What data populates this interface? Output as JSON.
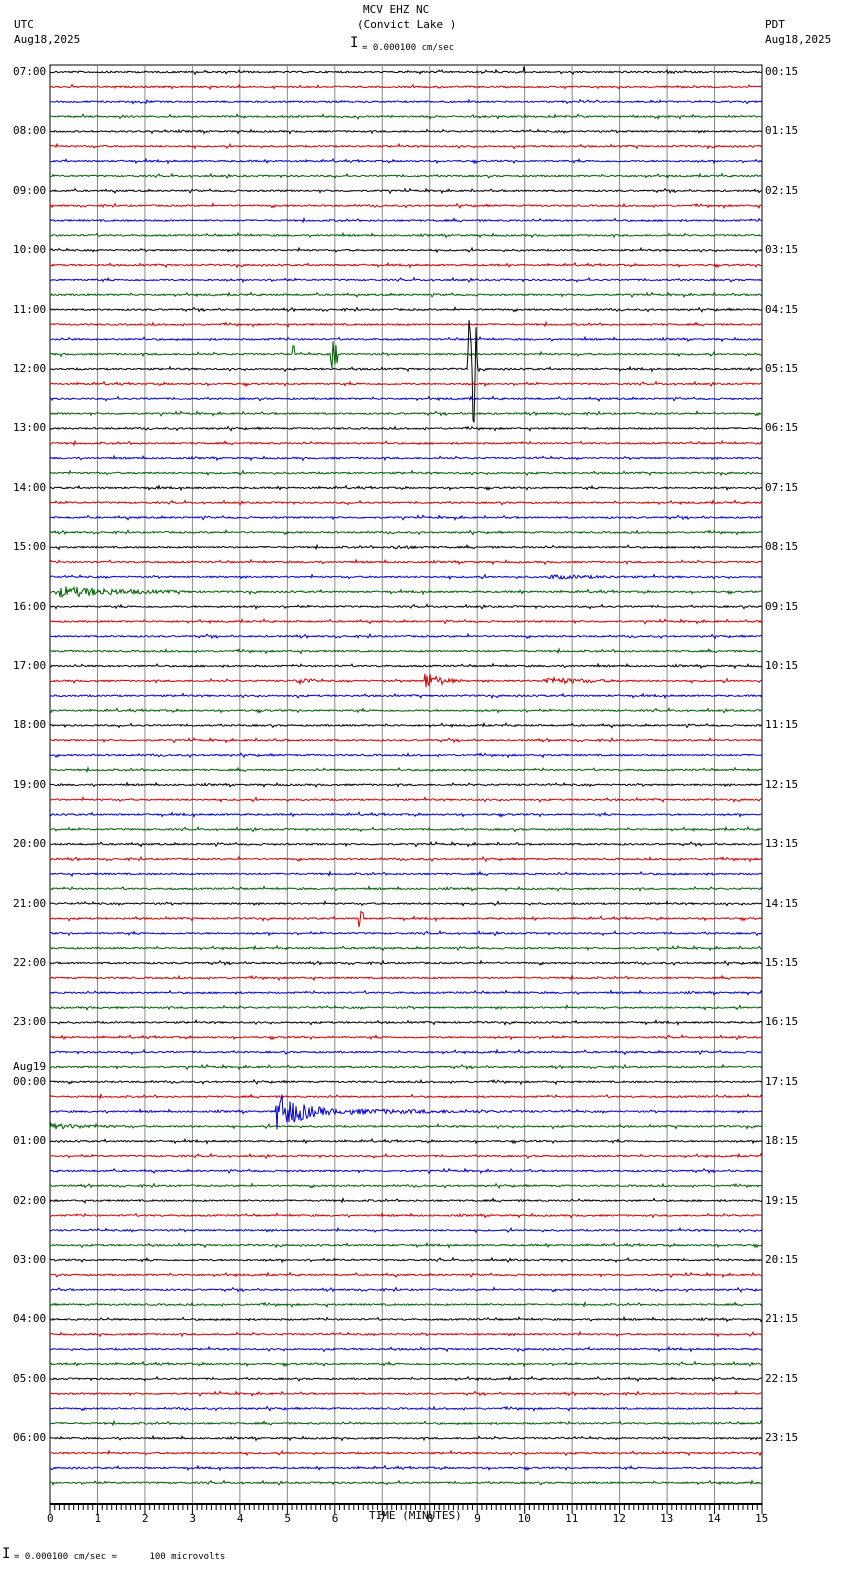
{
  "header": {
    "station": "MCV EHZ NC",
    "location": "(Convict Lake )",
    "scale": "= 0.000100 cm/sec",
    "left_tz": "UTC",
    "left_date": "Aug18,2025",
    "right_tz": "PDT",
    "right_date": "Aug18,2025"
  },
  "footer": {
    "scale": "= 0.000100 cm/sec =      100 microvolts"
  },
  "chart_data": {
    "type": "line",
    "title": "MCV EHZ NC (Convict Lake )",
    "xlabel": "TIME (MINUTES)",
    "xlim": [
      0,
      15
    ],
    "x_ticks": [
      "0",
      "1",
      "2",
      "3",
      "4",
      "5",
      "6",
      "7",
      "8",
      "9",
      "10",
      "11",
      "12",
      "13",
      "14",
      "15"
    ],
    "traces_per_hour": 4,
    "trace_colors": [
      "#000000",
      "#d00000",
      "#0000d0",
      "#006000"
    ],
    "left_labels": [
      "07:00",
      "08:00",
      "09:00",
      "10:00",
      "11:00",
      "12:00",
      "13:00",
      "14:00",
      "15:00",
      "16:00",
      "17:00",
      "18:00",
      "19:00",
      "20:00",
      "21:00",
      "22:00",
      "23:00",
      "00:00",
      "01:00",
      "02:00",
      "03:00",
      "04:00",
      "05:00",
      "06:00"
    ],
    "date_change_label": "Aug19",
    "right_labels": [
      "00:15",
      "01:15",
      "02:15",
      "03:15",
      "04:15",
      "05:15",
      "06:15",
      "07:15",
      "08:15",
      "09:15",
      "10:15",
      "11:15",
      "12:15",
      "13:15",
      "14:15",
      "15:15",
      "16:15",
      "17:15",
      "18:15",
      "19:15",
      "20:15",
      "21:15",
      "22:15",
      "23:15"
    ],
    "events": [
      {
        "trace": 0,
        "start": 9.95,
        "dur": 0.05,
        "amp": 6
      },
      {
        "trace": 19,
        "start": 5.1,
        "dur": 0.05,
        "amp": 14
      },
      {
        "trace": 19,
        "start": 5.9,
        "dur": 0.15,
        "amp": 16
      },
      {
        "trace": 20,
        "start": 8.8,
        "dur": 0.2,
        "amp": 60
      },
      {
        "trace": 28,
        "start": 2.2,
        "dur": 0.3,
        "amp": 3
      },
      {
        "trace": 32,
        "start": 7.2,
        "dur": 1.8,
        "amp": 2.5
      },
      {
        "trace": 34,
        "start": 10.5,
        "dur": 4.5,
        "amp": 2.5
      },
      {
        "trace": 35,
        "start": 0.2,
        "dur": 4,
        "amp": 6
      },
      {
        "trace": 41,
        "start": 5.2,
        "dur": 0.8,
        "amp": 5
      },
      {
        "trace": 41,
        "start": 7.9,
        "dur": 0.9,
        "amp": 10
      },
      {
        "trace": 41,
        "start": 10.4,
        "dur": 3,
        "amp": 4
      },
      {
        "trace": 57,
        "start": 6.5,
        "dur": 0.1,
        "amp": 9
      },
      {
        "trace": 70,
        "start": 4.75,
        "dur": 1.5,
        "amp": 22
      },
      {
        "trace": 70,
        "start": 6.2,
        "dur": 8.8,
        "amp": 3
      },
      {
        "trace": 71,
        "start": 0,
        "dur": 3.7,
        "amp": 3
      }
    ]
  }
}
